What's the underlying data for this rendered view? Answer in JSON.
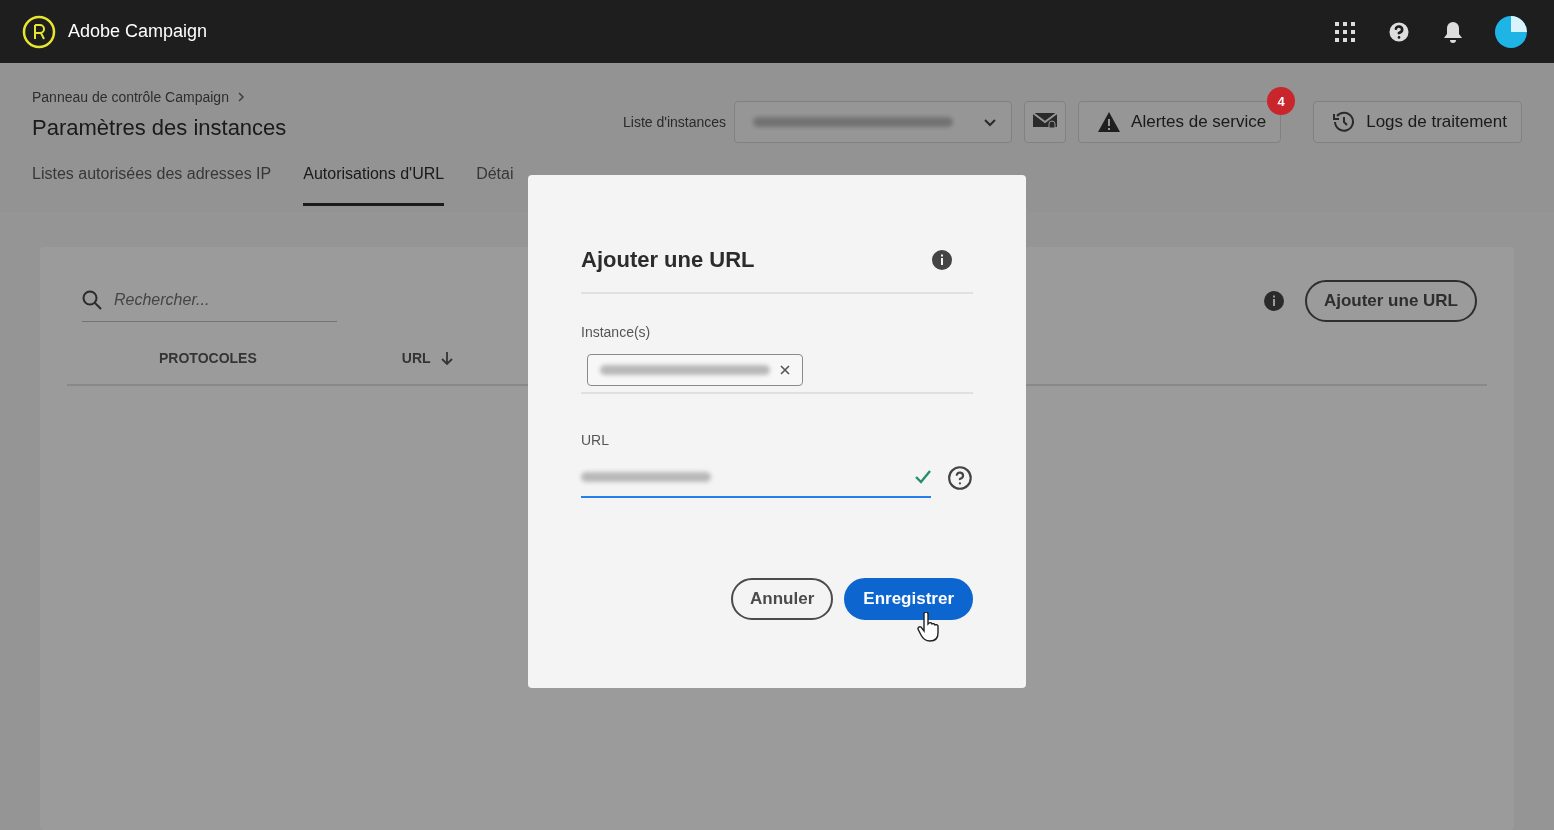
{
  "app": {
    "name": "Adobe Campaign"
  },
  "breadcrumb": "Panneau de contrôle Campaign",
  "page_title": "Paramètres des instances",
  "instance_list": {
    "label": "Liste d'instances"
  },
  "service_alerts": {
    "label": "Alertes de service",
    "badge": "4"
  },
  "logs": {
    "label": "Logs de traitement"
  },
  "tabs": [
    {
      "label": "Listes autorisées des adresses IP",
      "selected": false
    },
    {
      "label": "Autorisations d'URL",
      "selected": true
    },
    {
      "label": "Détai",
      "selected": false
    }
  ],
  "search": {
    "placeholder": "Rechercher..."
  },
  "add_url_button": "Ajouter une URL",
  "columns": [
    {
      "label": "PROTOCOLES",
      "sorted": false
    },
    {
      "label": "URL",
      "sorted": true
    }
  ],
  "dialog": {
    "title": "Ajouter une URL",
    "instances_label": "Instance(s)",
    "url_label": "URL",
    "url_valid": true,
    "buttons": [
      {
        "label": "Annuler",
        "kind": "secondary"
      },
      {
        "label": "Enregistrer",
        "kind": "primary"
      }
    ]
  }
}
